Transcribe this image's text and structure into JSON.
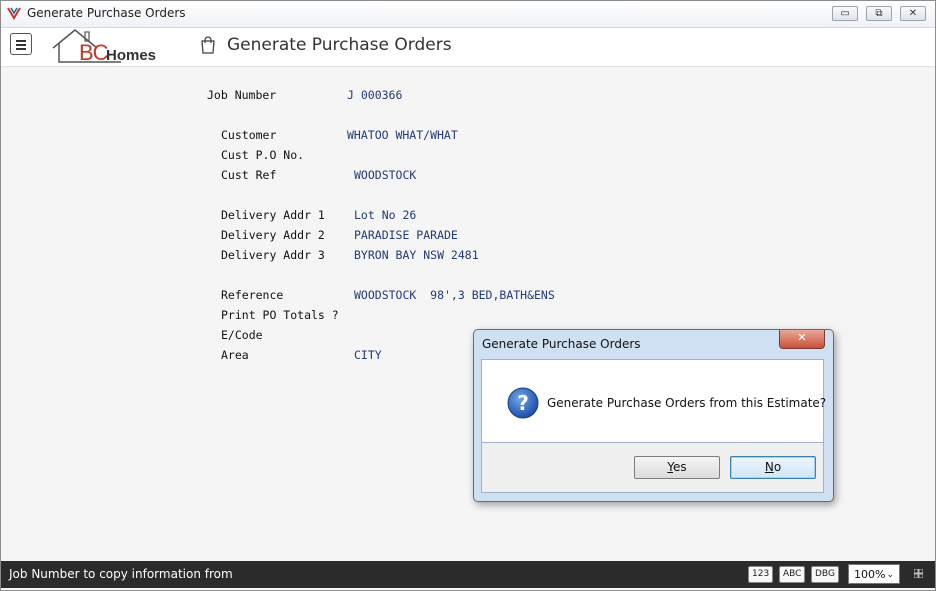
{
  "window": {
    "title": "Generate Purchase Orders",
    "controls": {
      "minimize": "▭",
      "restore": "⧉",
      "close": "✕"
    }
  },
  "header": {
    "logo_bc": "BC",
    "logo_homes": "Homes",
    "page_title": "Generate Purchase Orders",
    "icons": [
      "menu-icon",
      "house-logo-icon",
      "bag-icon"
    ]
  },
  "form": {
    "job_number": {
      "label": "Job Number",
      "value": "J 000366"
    },
    "customer": {
      "label": "Customer",
      "value": "WHATOO WHAT/WHAT"
    },
    "cust_po": {
      "label": "Cust P.O No.",
      "value": ""
    },
    "cust_ref": {
      "label": "Cust Ref",
      "value": "WOODSTOCK"
    },
    "delivery_addr_1": {
      "label": "Delivery Addr 1",
      "value": "Lot No 26"
    },
    "delivery_addr_2": {
      "label": "Delivery Addr 2",
      "value": "PARADISE PARADE"
    },
    "delivery_addr_3": {
      "label": "Delivery Addr 3",
      "value": "BYRON BAY NSW 2481"
    },
    "reference": {
      "label": "Reference",
      "value": "WOODSTOCK  98',3 BED,BATH&ENS"
    },
    "print_po_totals": {
      "label": "Print PO Totals ?",
      "value": ""
    },
    "ecode": {
      "label": "E/Code",
      "value": ""
    },
    "area": {
      "label": "Area",
      "value": "CITY"
    }
  },
  "dialog": {
    "title": "Generate Purchase Orders",
    "close": "✕",
    "message": "Generate Purchase Orders from this Estimate?",
    "yes_prefix": "Y",
    "yes_rest": "es",
    "no_prefix": "N",
    "no_rest": "o",
    "icon": "question-icon"
  },
  "statusbar": {
    "text": "Job Number to copy information from",
    "badges": [
      "123",
      "ABC",
      "DBG"
    ],
    "zoom": "100%",
    "zoom_chevron": "⌄"
  },
  "colors": {
    "value_text": "#223a78",
    "statusbar_bg": "#2b2b2b",
    "dialog_frame": "#cfe0f3",
    "logo_red": "#c0392b"
  }
}
